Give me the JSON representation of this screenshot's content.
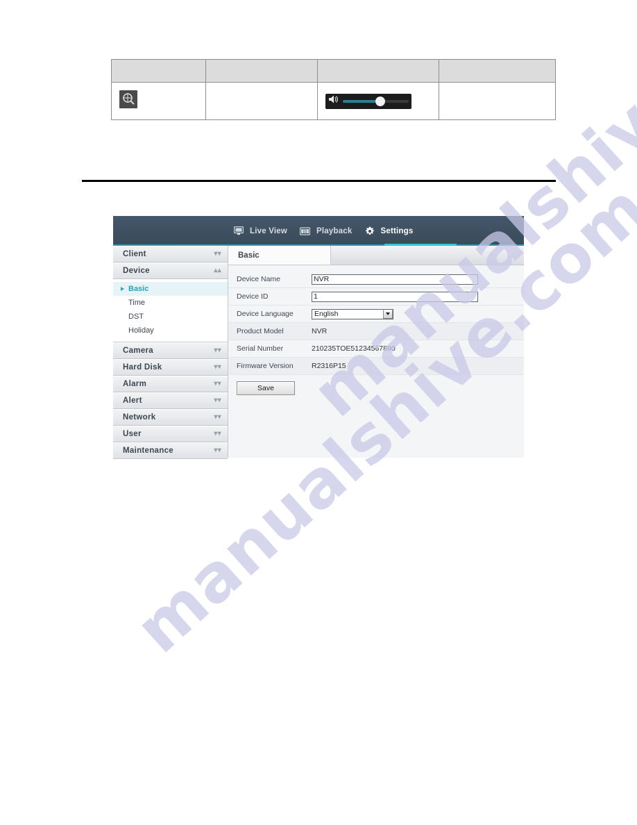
{
  "top_table": {
    "columns": [
      "",
      "",
      "",
      ""
    ],
    "header_cells": [
      "",
      "",
      "",
      ""
    ],
    "body_cells": [
      {
        "type": "icon",
        "icon": "zoom-in-icon",
        "label": ""
      },
      {
        "type": "empty",
        "label": ""
      },
      {
        "type": "volume",
        "icon": "speaker-icon",
        "label": "",
        "volume_percent": 56
      },
      {
        "type": "empty",
        "label": ""
      }
    ]
  },
  "app": {
    "nav": [
      {
        "label": "Live View",
        "icon": "monitor-icon",
        "active": false
      },
      {
        "label": "Playback",
        "icon": "filmstrip-icon",
        "active": false
      },
      {
        "label": "Settings",
        "icon": "gear-icon",
        "active": true
      }
    ],
    "sidebar": {
      "groups": [
        {
          "label": "Client",
          "expanded": false,
          "chevron": "chevron-down-icon"
        },
        {
          "label": "Device",
          "expanded": true,
          "chevron": "chevron-up-icon",
          "items": [
            {
              "label": "Basic",
              "active": true
            },
            {
              "label": "Time",
              "active": false
            },
            {
              "label": "DST",
              "active": false
            },
            {
              "label": "Holiday",
              "active": false
            }
          ]
        },
        {
          "label": "Camera",
          "expanded": false,
          "chevron": "chevron-down-icon"
        },
        {
          "label": "Hard Disk",
          "expanded": false,
          "chevron": "chevron-down-icon"
        },
        {
          "label": "Alarm",
          "expanded": false,
          "chevron": "chevron-down-icon"
        },
        {
          "label": "Alert",
          "expanded": false,
          "chevron": "chevron-down-icon"
        },
        {
          "label": "Network",
          "expanded": false,
          "chevron": "chevron-down-icon"
        },
        {
          "label": "User",
          "expanded": false,
          "chevron": "chevron-down-icon"
        },
        {
          "label": "Maintenance",
          "expanded": false,
          "chevron": "chevron-down-icon"
        }
      ]
    },
    "tabs": [
      {
        "label": "Basic",
        "active": true
      }
    ],
    "form": {
      "rows": [
        {
          "label": "Device Name",
          "value": "NVR",
          "kind": "input"
        },
        {
          "label": "Device ID",
          "value": "1",
          "kind": "input"
        },
        {
          "label": "Device Language",
          "value": "English",
          "kind": "select"
        },
        {
          "label": "Product Model",
          "value": "NVR",
          "kind": "text"
        },
        {
          "label": "Serial Number",
          "value": "210235TOE51234567890",
          "kind": "text"
        },
        {
          "label": "Firmware Version",
          "value": "R2316P15",
          "kind": "text"
        }
      ],
      "save_label": "Save"
    },
    "colors": {
      "header_bg": "#3d4f5e",
      "accent": "#2aa3b8",
      "accent_bright": "#38c6dd",
      "panel_bg": "#f4f5f7"
    }
  },
  "watermark": {
    "text_a": "manualshive.com",
    "text_b": "manualshive.com",
    "color": "#c9c9e8"
  }
}
